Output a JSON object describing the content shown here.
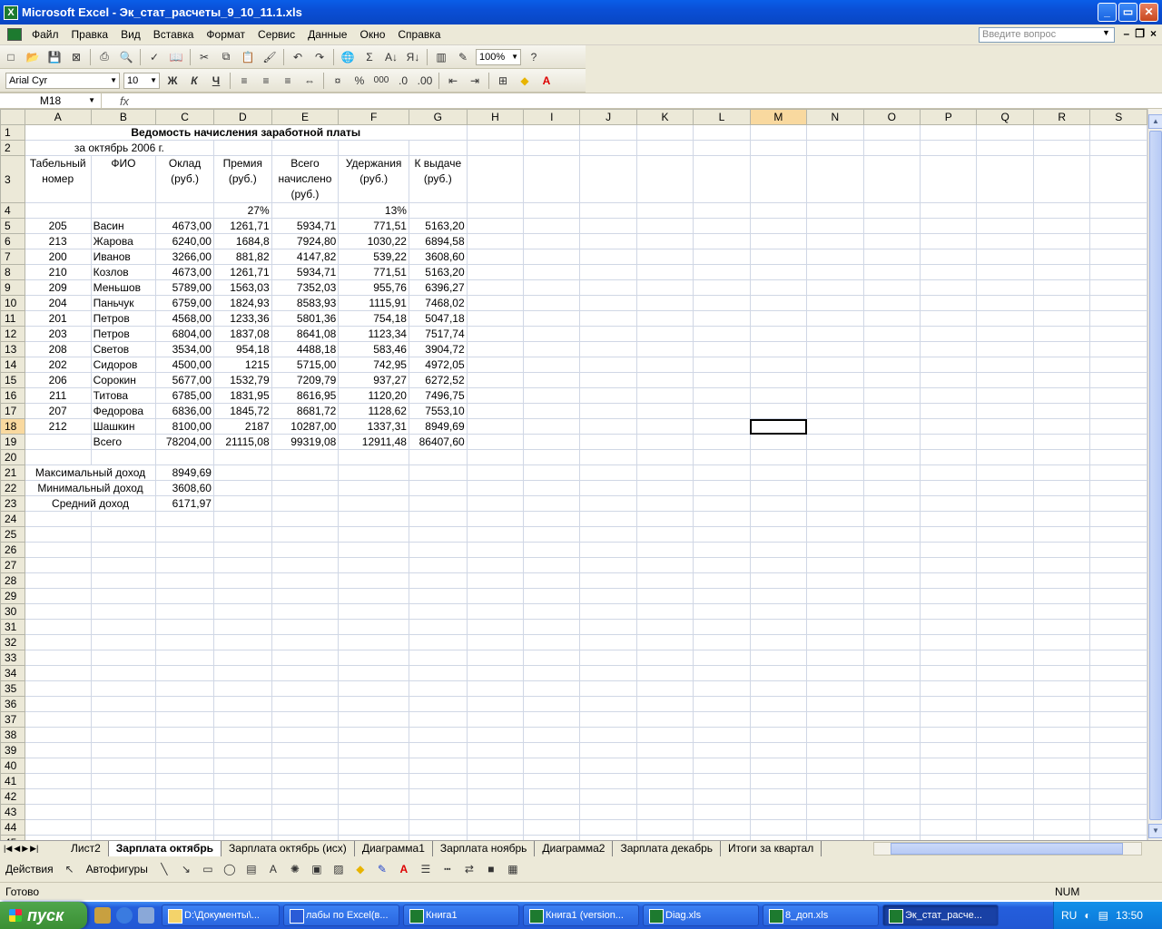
{
  "window": {
    "title": "Microsoft Excel - Эк_стат_расчеты_9_10_11.1.xls",
    "app_icon": "X",
    "btn_min": "_",
    "btn_max": "▭",
    "btn_close": "✕"
  },
  "menu": {
    "items": [
      "Файл",
      "Правка",
      "Вид",
      "Вставка",
      "Формат",
      "Сервис",
      "Данные",
      "Окно",
      "Справка"
    ],
    "question_placeholder": "Введите вопрос"
  },
  "toolbar": {
    "zoom": "100%",
    "font": "Arial Cyr",
    "size": "10",
    "bold": "Ж",
    "italic": "К",
    "underline": "Ч",
    "percent": "%",
    "thousands": "000"
  },
  "formula": {
    "namebox": "M18",
    "fx": "fx"
  },
  "columns": [
    "A",
    "B",
    "C",
    "D",
    "E",
    "F",
    "G",
    "H",
    "I",
    "J",
    "K",
    "L",
    "M",
    "N",
    "O",
    "P",
    "Q",
    "R",
    "S"
  ],
  "sheet": {
    "title": "Ведомость начисления заработной платы",
    "subtitle": "за октябрь 2006 г.",
    "headers": [
      "Табельный номер",
      "ФИО",
      "Оклад (руб.)",
      "Премия (руб.)",
      "Всего начислено (руб.)",
      "Удержания (руб.)",
      "К выдаче (руб.)"
    ],
    "premium_rate": "27%",
    "deduction_rate": "13%",
    "rows": [
      [
        "205",
        "Васин",
        "4673,00",
        "1261,71",
        "5934,71",
        "771,51",
        "5163,20"
      ],
      [
        "213",
        "Жарова",
        "6240,00",
        "1684,8",
        "7924,80",
        "1030,22",
        "6894,58"
      ],
      [
        "200",
        "Иванов",
        "3266,00",
        "881,82",
        "4147,82",
        "539,22",
        "3608,60"
      ],
      [
        "210",
        "Козлов",
        "4673,00",
        "1261,71",
        "5934,71",
        "771,51",
        "5163,20"
      ],
      [
        "209",
        "Меньшов",
        "5789,00",
        "1563,03",
        "7352,03",
        "955,76",
        "6396,27"
      ],
      [
        "204",
        "Паньчук",
        "6759,00",
        "1824,93",
        "8583,93",
        "1115,91",
        "7468,02"
      ],
      [
        "201",
        "Петров",
        "4568,00",
        "1233,36",
        "5801,36",
        "754,18",
        "5047,18"
      ],
      [
        "203",
        "Петров",
        "6804,00",
        "1837,08",
        "8641,08",
        "1123,34",
        "7517,74"
      ],
      [
        "208",
        "Светов",
        "3534,00",
        "954,18",
        "4488,18",
        "583,46",
        "3904,72"
      ],
      [
        "202",
        "Сидоров",
        "4500,00",
        "1215",
        "5715,00",
        "742,95",
        "4972,05"
      ],
      [
        "206",
        "Сорокин",
        "5677,00",
        "1532,79",
        "7209,79",
        "937,27",
        "6272,52"
      ],
      [
        "211",
        "Титова",
        "6785,00",
        "1831,95",
        "8616,95",
        "1120,20",
        "7496,75"
      ],
      [
        "207",
        "Федорова",
        "6836,00",
        "1845,72",
        "8681,72",
        "1128,62",
        "7553,10"
      ],
      [
        "212",
        "Шашкин",
        "8100,00",
        "2187",
        "10287,00",
        "1337,31",
        "8949,69"
      ]
    ],
    "total": [
      "Всего",
      "78204,00",
      "21115,08",
      "99319,08",
      "12911,48",
      "86407,60"
    ],
    "stats": [
      [
        "Максимальный доход",
        "8949,69"
      ],
      [
        "Минимальный доход",
        "3608,60"
      ],
      [
        "Средний доход",
        "6171,97"
      ]
    ]
  },
  "tabs": [
    "Лист2",
    "Зарплата октябрь",
    "Зарплата октябрь (исх)",
    "Диаграмма1",
    "Зарплата ноябрь",
    "Диаграмма2",
    "Зарплата декабрь",
    "Итоги за квартал"
  ],
  "drawing": {
    "actions": "Действия",
    "autoshapes": "Автофигуры"
  },
  "status": {
    "ready": "Готово",
    "num": "NUM"
  },
  "taskbar": {
    "start": "пуск",
    "tasks": [
      "D:\\Документы\\...",
      "лабы по Excel(в...",
      "Книга1",
      "Книга1 (version...",
      "Diag.xls",
      "8_доп.xls",
      "Эк_стат_расче..."
    ],
    "lang": "RU",
    "clock": "13:50"
  }
}
